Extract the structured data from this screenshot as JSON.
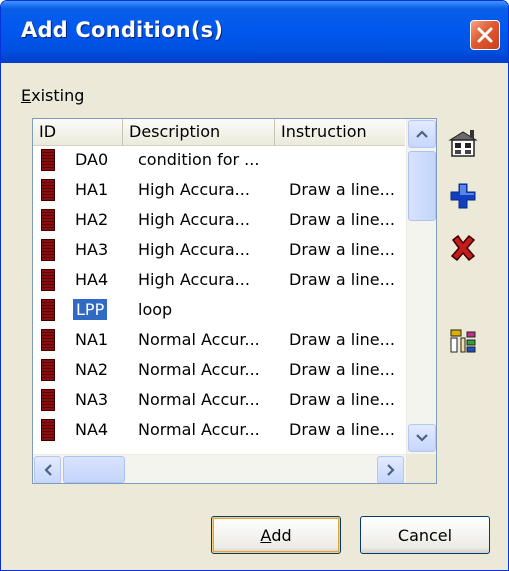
{
  "window": {
    "title": "Add Condition(s)"
  },
  "existing_label": {
    "accel": "E",
    "rest": "xisting"
  },
  "list": {
    "columns": [
      "ID",
      "Description",
      "Instruction"
    ],
    "rows": [
      {
        "id": "DA0",
        "description": "condition for ...",
        "instruction": "",
        "selected": false
      },
      {
        "id": "HA1",
        "description": "High Accura...",
        "instruction": "Draw a line...",
        "selected": false
      },
      {
        "id": "HA2",
        "description": "High Accura...",
        "instruction": "Draw a line...",
        "selected": false
      },
      {
        "id": "HA3",
        "description": "High Accura...",
        "instruction": "Draw a line...",
        "selected": false
      },
      {
        "id": "HA4",
        "description": "High Accura...",
        "instruction": "Draw a line...",
        "selected": false
      },
      {
        "id": "LPP",
        "description": "loop",
        "instruction": "",
        "selected": true
      },
      {
        "id": "NA1",
        "description": "Normal Accur...",
        "instruction": "Draw a line...",
        "selected": false
      },
      {
        "id": "NA2",
        "description": "Normal Accur...",
        "instruction": "Draw a line...",
        "selected": false
      },
      {
        "id": "NA3",
        "description": "Normal Accur...",
        "instruction": "Draw a line...",
        "selected": false
      },
      {
        "id": "NA4",
        "description": "Normal Accur...",
        "instruction": "Draw a line...",
        "selected": false
      }
    ]
  },
  "toolbar": {
    "items": [
      {
        "name": "edit-condition-icon"
      },
      {
        "name": "add-condition-icon"
      },
      {
        "name": "delete-condition-icon"
      },
      {
        "name": "tree-view-icon"
      }
    ]
  },
  "buttons": {
    "add": {
      "accel": "A",
      "rest": "dd"
    },
    "cancel": "Cancel"
  },
  "colors": {
    "title_bar": "#0058ee",
    "selection": "#316ac5",
    "row_icon": "#8b0d0d",
    "delete_x": "#c81a1a",
    "add_plus": "#1040c0"
  }
}
